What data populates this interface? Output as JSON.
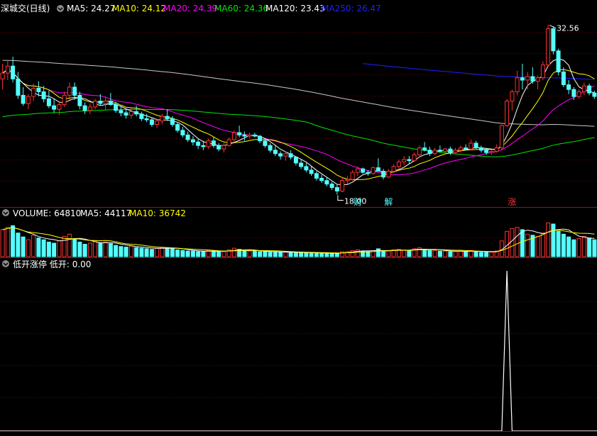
{
  "colors": {
    "background": "#000000",
    "up": "#ff3232",
    "down": "#54ffff",
    "separator": "#c00000",
    "grid": "#7a0000",
    "ma5": "#ffffff",
    "ma10": "#ffff00",
    "ma20": "#ff00ff",
    "ma60": "#00e600",
    "ma120": "#c8c8c8",
    "ma250": "#2020ff",
    "signal": "#ffffff"
  },
  "price_panel": {
    "title": "深城交(日线)",
    "indicators": [
      {
        "label": "MA5:",
        "value": "24.27",
        "color": "#ffffff"
      },
      {
        "label": "MA10:",
        "value": "24.12",
        "color": "#ffff00"
      },
      {
        "label": "MA20:",
        "value": "24.39",
        "color": "#ff00ff"
      },
      {
        "label": "MA60:",
        "value": "24.36",
        "color": "#00e600"
      },
      {
        "label": "MA120:",
        "value": "23.43",
        "color": "#ffffff"
      },
      {
        "label": "MA250:",
        "value": "26.47",
        "color": "#2020ff"
      }
    ],
    "high_label": "32.56",
    "low_label": "18.00",
    "markers": [
      "财",
      "解",
      "涨"
    ]
  },
  "volume_panel": {
    "title": "VOLUME:",
    "value": "64810",
    "indicators": [
      {
        "label": "MA5:",
        "value": "44117",
        "color": "#ffffff"
      },
      {
        "label": "MA10:",
        "value": "36742",
        "color": "#ffff00"
      }
    ]
  },
  "signal_panel": {
    "title": "低开涨停",
    "label": "低开:",
    "value": "0.00"
  },
  "chart_data": [
    {
      "type": "candlestick",
      "title": "深城交(日线)",
      "price_range": [
        18.0,
        32.56
      ],
      "ohlc": [
        [
          27.9,
          29.2,
          27.0,
          28.4
        ],
        [
          28.4,
          29.5,
          27.8,
          29.0
        ],
        [
          29.0,
          29.8,
          27.6,
          27.9
        ],
        [
          27.9,
          28.5,
          26.2,
          26.5
        ],
        [
          26.5,
          27.2,
          25.6,
          25.8
        ],
        [
          25.8,
          26.6,
          25.3,
          26.4
        ],
        [
          26.4,
          27.5,
          26.0,
          27.1
        ],
        [
          27.1,
          27.7,
          26.4,
          26.8
        ],
        [
          26.8,
          27.3,
          25.9,
          26.2
        ],
        [
          26.2,
          26.9,
          25.4,
          25.6
        ],
        [
          25.6,
          26.2,
          25.0,
          25.3
        ],
        [
          25.3,
          26.0,
          24.8,
          25.7
        ],
        [
          25.7,
          26.8,
          25.5,
          26.5
        ],
        [
          26.5,
          27.6,
          26.1,
          27.2
        ],
        [
          27.2,
          27.6,
          26.1,
          26.5
        ],
        [
          26.5,
          26.8,
          25.3,
          25.6
        ],
        [
          25.6,
          25.9,
          24.9,
          25.2
        ],
        [
          25.2,
          25.8,
          24.9,
          25.5
        ],
        [
          25.5,
          26.2,
          25.3,
          26.0
        ],
        [
          26.0,
          26.6,
          25.6,
          25.8
        ],
        [
          25.8,
          26.4,
          25.2,
          26.0
        ],
        [
          26.0,
          26.7,
          25.6,
          25.7
        ],
        [
          25.7,
          25.9,
          25.0,
          25.2
        ],
        [
          25.2,
          25.6,
          24.7,
          25.0
        ],
        [
          25.0,
          25.3,
          24.5,
          24.8
        ],
        [
          24.8,
          25.4,
          24.5,
          25.1
        ],
        [
          25.1,
          25.6,
          24.7,
          24.9
        ],
        [
          24.9,
          25.1,
          24.3,
          24.5
        ],
        [
          24.5,
          24.9,
          24.2,
          24.4
        ],
        [
          24.4,
          24.6,
          23.8,
          24.0
        ],
        [
          24.0,
          24.5,
          23.7,
          24.3
        ],
        [
          24.3,
          24.9,
          24.0,
          24.7
        ],
        [
          24.7,
          25.3,
          24.3,
          24.5
        ],
        [
          24.5,
          24.7,
          23.8,
          24.0
        ],
        [
          24.0,
          24.2,
          23.3,
          23.5
        ],
        [
          23.5,
          23.8,
          22.9,
          23.1
        ],
        [
          23.1,
          23.4,
          22.5,
          22.7
        ],
        [
          22.7,
          23.0,
          22.2,
          22.5
        ],
        [
          22.5,
          22.8,
          21.9,
          22.2
        ],
        [
          22.2,
          22.6,
          21.8,
          22.1
        ],
        [
          22.1,
          22.8,
          21.9,
          22.6
        ],
        [
          22.6,
          22.9,
          22.0,
          22.2
        ],
        [
          22.2,
          22.4,
          21.7,
          21.9
        ],
        [
          21.9,
          22.4,
          21.6,
          22.2
        ],
        [
          22.2,
          22.9,
          22.1,
          22.7
        ],
        [
          22.7,
          23.5,
          22.5,
          23.3
        ],
        [
          23.3,
          23.9,
          22.9,
          23.1
        ],
        [
          23.1,
          23.4,
          22.6,
          23.0
        ],
        [
          23.0,
          23.3,
          22.8,
          23.1
        ],
        [
          23.1,
          23.3,
          22.9,
          23.0
        ],
        [
          23.0,
          23.1,
          22.4,
          22.6
        ],
        [
          22.6,
          22.8,
          22.0,
          22.2
        ],
        [
          22.2,
          22.4,
          21.6,
          21.8
        ],
        [
          21.8,
          22.2,
          21.3,
          21.5
        ],
        [
          21.5,
          21.7,
          21.0,
          21.3
        ],
        [
          21.3,
          21.7,
          20.9,
          21.5
        ],
        [
          21.5,
          21.8,
          21.0,
          21.2
        ],
        [
          21.2,
          21.3,
          20.5,
          20.7
        ],
        [
          20.7,
          21.0,
          20.2,
          20.4
        ],
        [
          20.4,
          20.7,
          19.9,
          20.1
        ],
        [
          20.1,
          20.4,
          19.6,
          19.8
        ],
        [
          19.8,
          20.0,
          19.2,
          19.4
        ],
        [
          19.4,
          19.7,
          19.0,
          19.2
        ],
        [
          19.2,
          19.5,
          18.7,
          18.9
        ],
        [
          18.9,
          19.1,
          18.4,
          18.6
        ],
        [
          18.6,
          18.9,
          18.0,
          18.3
        ],
        [
          18.3,
          19.5,
          18.2,
          19.2
        ],
        [
          19.2,
          19.6,
          18.9,
          19.3
        ],
        [
          19.3,
          20.1,
          19.2,
          19.9
        ],
        [
          19.9,
          20.4,
          19.6,
          20.2
        ],
        [
          20.2,
          20.3,
          19.8,
          19.9
        ],
        [
          19.9,
          20.1,
          19.6,
          19.8
        ],
        [
          19.8,
          20.4,
          19.7,
          20.3
        ],
        [
          20.3,
          21.1,
          20.1,
          20.0
        ],
        [
          20.0,
          20.2,
          19.3,
          19.5
        ],
        [
          19.5,
          20.2,
          19.4,
          20.0
        ],
        [
          20.0,
          20.6,
          19.9,
          20.4
        ],
        [
          20.4,
          21.0,
          20.2,
          20.8
        ],
        [
          20.8,
          21.3,
          20.5,
          21.0
        ],
        [
          21.0,
          21.3,
          20.6,
          20.9
        ],
        [
          20.9,
          21.6,
          20.8,
          21.4
        ],
        [
          21.4,
          22.2,
          21.2,
          22.0
        ],
        [
          22.0,
          22.5,
          21.7,
          21.8
        ],
        [
          21.8,
          22.1,
          21.3,
          21.5
        ],
        [
          21.5,
          22.0,
          21.4,
          21.8
        ],
        [
          21.8,
          22.2,
          21.6,
          21.7
        ],
        [
          21.7,
          22.0,
          21.5,
          21.9
        ],
        [
          21.9,
          22.1,
          21.4,
          21.6
        ],
        [
          21.6,
          22.0,
          21.5,
          21.8
        ],
        [
          21.8,
          22.2,
          21.6,
          22.0
        ],
        [
          22.0,
          22.3,
          21.8,
          21.9
        ],
        [
          21.9,
          22.7,
          21.8,
          22.4
        ],
        [
          22.4,
          22.6,
          21.9,
          22.0
        ],
        [
          22.0,
          22.2,
          21.6,
          21.8
        ],
        [
          21.8,
          22.0,
          21.4,
          21.6
        ],
        [
          21.6,
          21.8,
          21.4,
          21.7
        ],
        [
          21.7,
          22.3,
          21.6,
          22.0
        ],
        [
          22.0,
          24.0,
          21.8,
          23.9
        ],
        [
          23.9,
          26.2,
          23.8,
          26.0
        ],
        [
          26.0,
          27.0,
          25.2,
          26.8
        ],
        [
          26.8,
          28.6,
          26.5,
          28.0
        ],
        [
          28.0,
          29.2,
          27.0,
          27.8
        ],
        [
          27.8,
          28.5,
          27.0,
          28.1
        ],
        [
          28.1,
          28.9,
          27.5,
          27.7
        ],
        [
          27.7,
          28.2,
          27.0,
          28.0
        ],
        [
          28.0,
          29.4,
          27.8,
          29.1
        ],
        [
          29.1,
          32.56,
          28.9,
          32.2
        ],
        [
          32.2,
          32.4,
          30.0,
          30.3
        ],
        [
          30.3,
          30.5,
          28.2,
          28.5
        ],
        [
          28.5,
          28.9,
          27.2,
          27.4
        ],
        [
          27.4,
          27.8,
          26.6,
          27.0
        ],
        [
          27.0,
          27.2,
          26.1,
          26.4
        ],
        [
          26.4,
          27.0,
          26.2,
          26.8
        ],
        [
          26.8,
          27.6,
          26.5,
          27.3
        ],
        [
          27.3,
          27.5,
          26.5,
          26.7
        ],
        [
          26.7,
          26.9,
          26.2,
          26.4
        ]
      ],
      "volume": [
        48,
        52,
        55,
        42,
        35,
        30,
        38,
        33,
        30,
        26,
        24,
        28,
        36,
        40,
        32,
        26,
        22,
        24,
        28,
        24,
        26,
        23,
        20,
        18,
        17,
        19,
        16,
        15,
        14,
        13,
        15,
        17,
        16,
        14,
        12,
        11,
        10,
        10,
        9,
        9,
        11,
        10,
        9,
        9,
        12,
        15,
        13,
        11,
        10,
        10,
        9,
        9,
        8,
        8,
        8,
        8,
        8,
        7,
        7,
        7,
        7,
        6,
        6,
        6,
        6,
        6,
        9,
        9,
        11,
        12,
        10,
        9,
        11,
        14,
        10,
        10,
        12,
        13,
        12,
        11,
        14,
        16,
        13,
        11,
        11,
        10,
        10,
        9,
        9,
        10,
        9,
        11,
        9,
        8,
        8,
        8,
        10,
        28,
        45,
        50,
        52,
        48,
        40,
        38,
        36,
        42,
        60,
        58,
        45,
        40,
        35,
        30,
        32,
        36,
        33,
        30
      ],
      "signal": {
        "index": 98,
        "value": 1
      }
    }
  ]
}
